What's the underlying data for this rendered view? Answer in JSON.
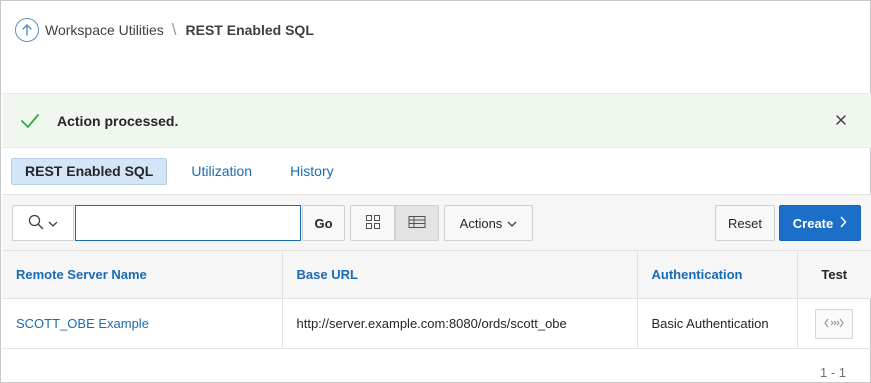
{
  "breadcrumb": {
    "parent": "Workspace Utilities",
    "separator": "\\",
    "current": "REST Enabled SQL"
  },
  "alert": {
    "message": "Action processed.",
    "color": "#eff7ef",
    "icon": "check-icon"
  },
  "tabs": [
    {
      "label": "REST Enabled SQL",
      "active": true
    },
    {
      "label": "Utilization",
      "active": false
    },
    {
      "label": "History",
      "active": false
    }
  ],
  "toolbar": {
    "search_value": "",
    "go_label": "Go",
    "actions_label": "Actions",
    "reset_label": "Reset",
    "create_label": "Create",
    "accent_color": "#1c6fc8"
  },
  "table": {
    "columns": [
      "Remote Server Name",
      "Base URL",
      "Authentication",
      "Test"
    ],
    "rows": [
      {
        "name": "SCOTT_OBE Example",
        "base_url": "http://server.example.com:8080/ords/scott_obe",
        "authentication": "Basic Authentication"
      }
    ]
  },
  "pagination": "1 - 1"
}
